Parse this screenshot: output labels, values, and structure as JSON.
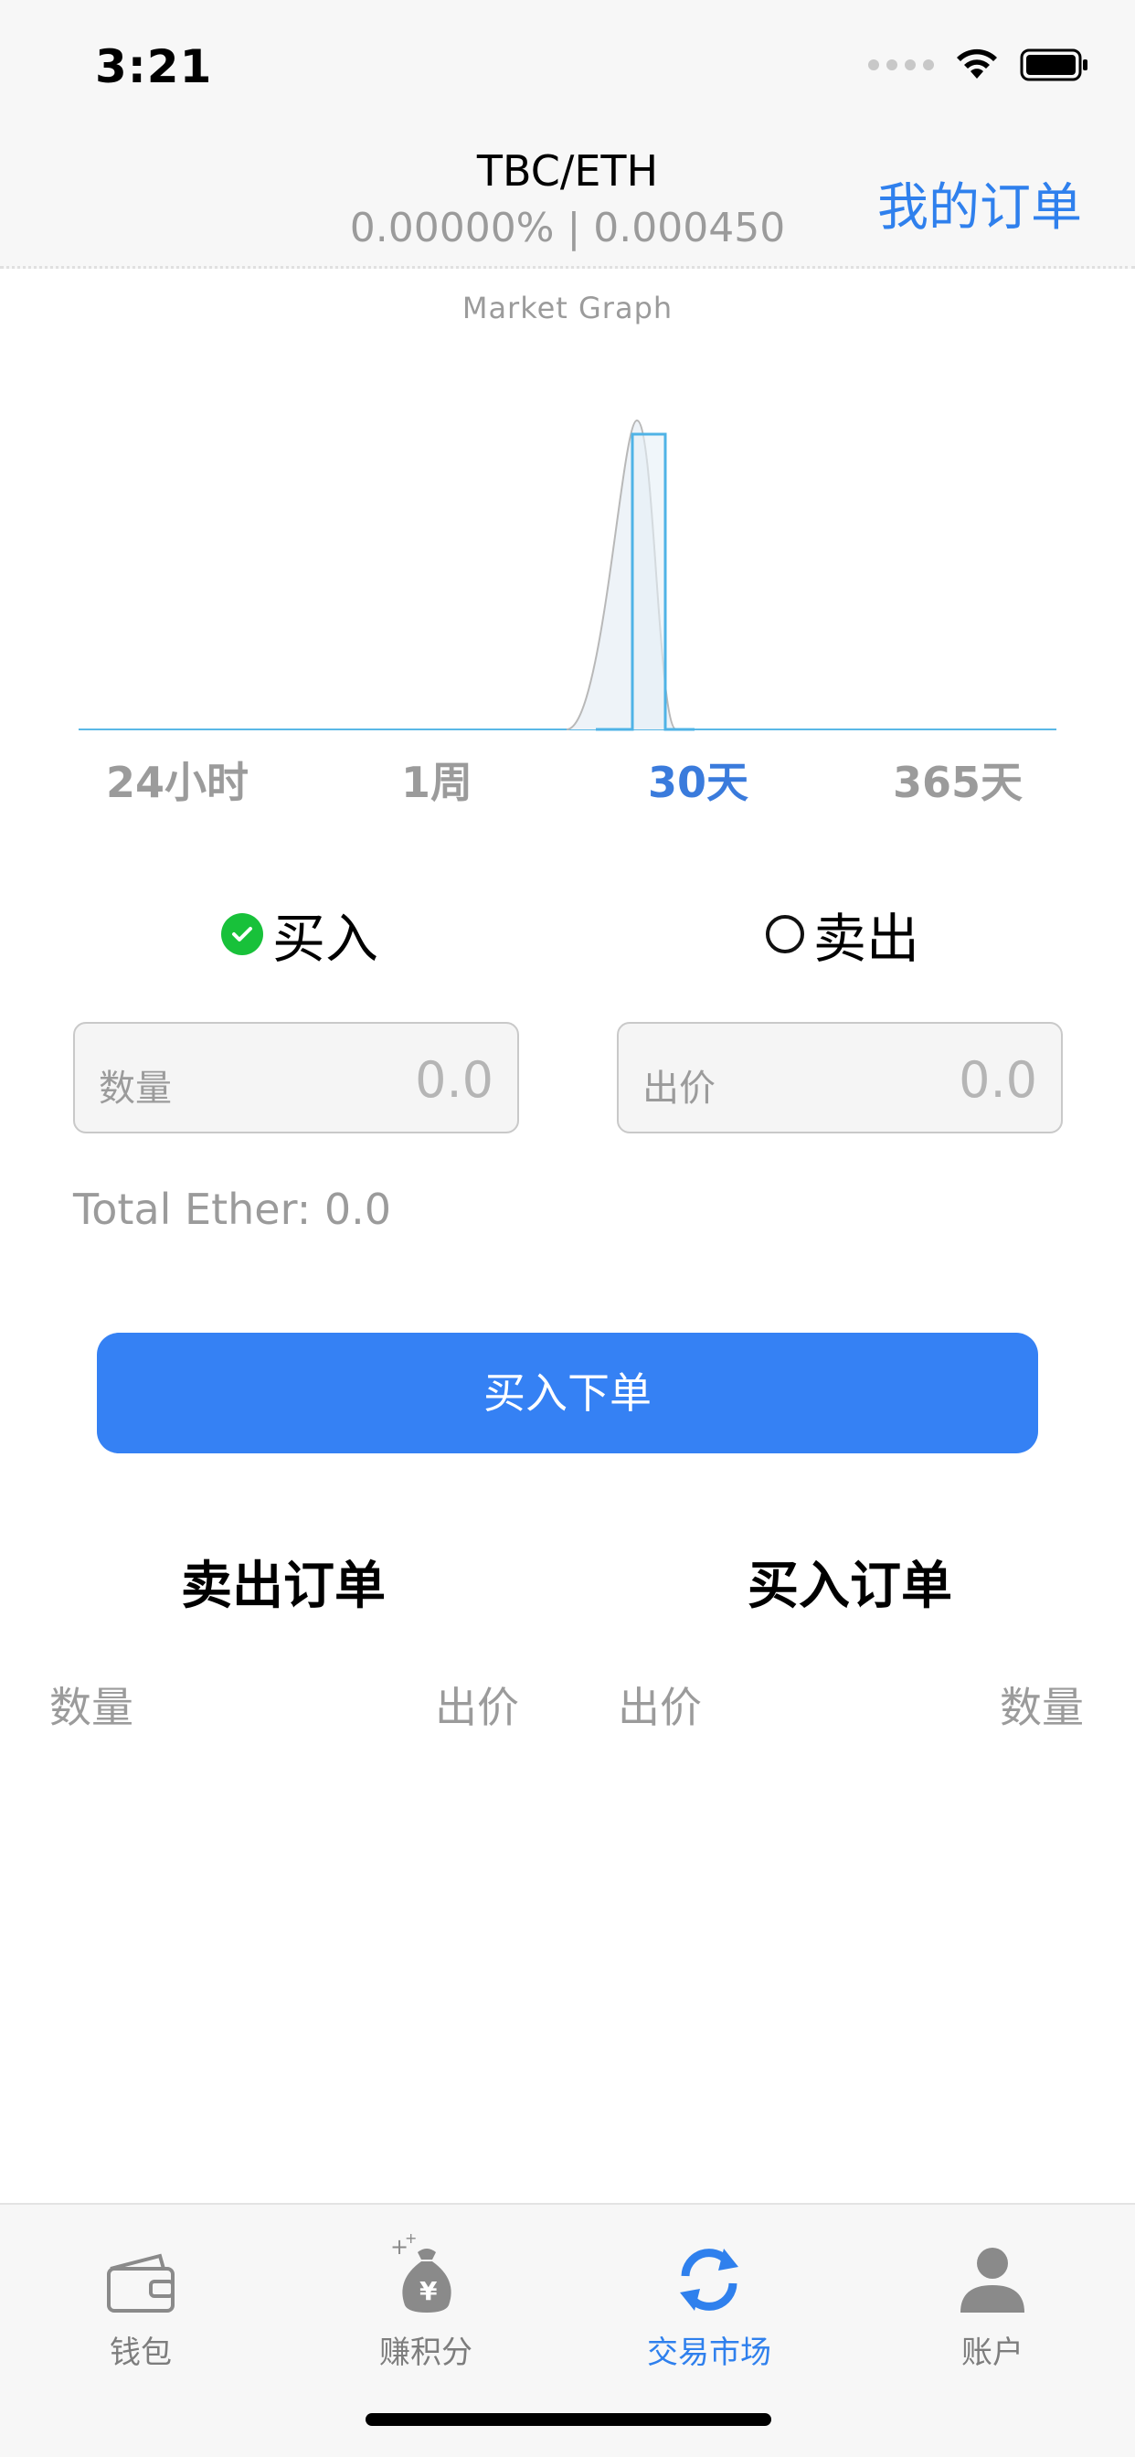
{
  "status": {
    "time": "3:21"
  },
  "nav": {
    "title": "TBC/ETH",
    "subtitle": "0.00000% | 0.000450",
    "right_action": "我的订单"
  },
  "graph": {
    "caption": "Market Graph",
    "ranges": [
      "24小时",
      "1周",
      "30天",
      "365天"
    ],
    "active_range": "30天"
  },
  "side": {
    "buy_label": "买入",
    "sell_label": "卖出",
    "selected": "buy"
  },
  "form": {
    "quantity_label": "数量",
    "quantity_value": "0.0",
    "price_label": "出价",
    "price_value": "0.0",
    "total": "Total Ether: 0.0",
    "submit_label": "买入下单"
  },
  "order_book": {
    "sell_title": "卖出订单",
    "buy_title": "买入订单",
    "sell_columns": [
      "数量",
      "出价"
    ],
    "buy_columns": [
      "出价",
      "数量"
    ]
  },
  "tabs": [
    {
      "label": "钱包",
      "icon": "wallet-icon"
    },
    {
      "label": "赚积分",
      "icon": "money-bag-icon"
    },
    {
      "label": "交易市场",
      "icon": "exchange-icon",
      "active": true
    },
    {
      "label": "账户",
      "icon": "person-icon"
    }
  ],
  "colors": {
    "accent": "#2f80ed",
    "button": "#3581f4",
    "check": "#18c13a",
    "muted": "#9b9b9b"
  }
}
